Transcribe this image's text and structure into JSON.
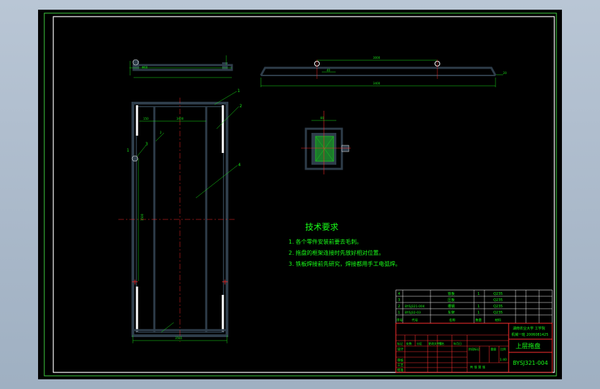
{
  "colors": {
    "background": "#000000",
    "border": "#3fd13f",
    "outline": "#ffffff",
    "part": "#2e3d4a",
    "dimension": "#19e619",
    "centerline": "#ff2a2a",
    "text": "#19ff19",
    "table_grid": "#ff3030"
  },
  "top_left_view": {
    "dim_left": "Φ60"
  },
  "top_right_view": {
    "dim_top": "3000",
    "dim_bottom": "3400",
    "dim_left_small": "40",
    "dim_right": "20"
  },
  "section_view": {
    "dim_top": "80"
  },
  "front_view": {
    "dim_width_bottom": "3565",
    "dim_inner_top_1": "150",
    "dim_inner_top_2": "3400",
    "dim_height": "1500",
    "callouts": [
      "1",
      "2",
      "3",
      "4",
      "2",
      "1"
    ]
  },
  "notes": {
    "title": "技术要求",
    "items": [
      "1. 各个零件安装前要去毛刺。",
      "2. 拖盘的框架连接时先放好相对位置。",
      "3. 铁板焊接前先研究，焊接都用手工电弧焊。"
    ]
  },
  "bom": {
    "rows": [
      {
        "no": "4",
        "code": "",
        "name": "铁板",
        "qty": "1",
        "material": "Q235"
      },
      {
        "no": "3",
        "code": "",
        "name": "压板",
        "qty": "",
        "material": "Q235"
      },
      {
        "no": "2",
        "code": "BYSJ321-004",
        "name": "槽钢",
        "qty": "1",
        "material": "Q235"
      },
      {
        "no": "1",
        "code": "BYSJ32-03",
        "name": "车架",
        "qty": "1",
        "material": "Q235"
      }
    ],
    "header": {
      "no": "序号",
      "code": "代号",
      "name": "名称",
      "qty": "数量",
      "material": "材料"
    }
  },
  "title_block": {
    "school": "湖南农业大学 工学院",
    "class": "机械一班 2006081425",
    "part_name": "上层拖盘",
    "drawing_no": "BYSJ321-004",
    "scale_label": "比例",
    "scale_value": "1:40",
    "sheet_label": "共 张 第 张",
    "roles": [
      "设计",
      "审核",
      "工艺",
      "批准"
    ],
    "header_cells": [
      "标记",
      "处数",
      "分区",
      "更改文件号",
      "签名",
      "年月日"
    ],
    "stage": [
      "阶段标记",
      "重量",
      "比例"
    ]
  }
}
